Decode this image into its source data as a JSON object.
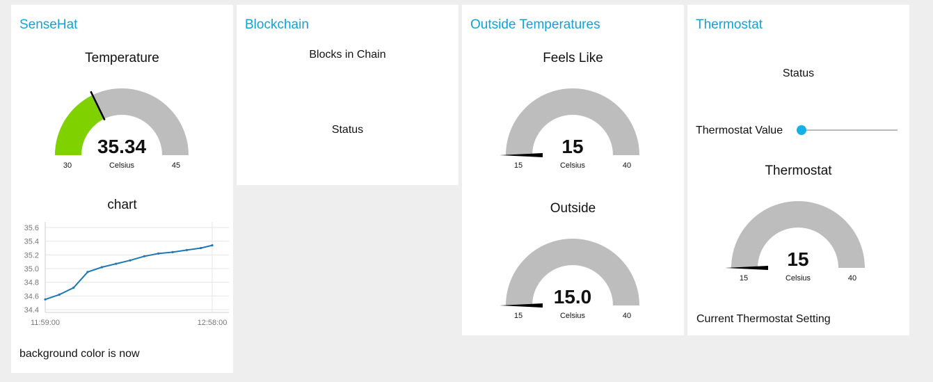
{
  "colors": {
    "background": "#eeeeee",
    "card": "#ffffff",
    "title_accent": "#0fa3d8",
    "gauge_fill": "#7fd100",
    "gauge_empty": "#bdbdbd",
    "chart_line": "#1f77b4",
    "slider_thumb": "#14b1e7"
  },
  "sensehat": {
    "title": "SenseHat",
    "temp_gauge": {
      "title": "Temperature",
      "value": "35.34",
      "unit": "Celsius",
      "min": "30",
      "max": "45",
      "level": 0.356
    },
    "chart_title": "chart",
    "footer": "background color is now"
  },
  "blockchain": {
    "title": "Blockchain",
    "blocks_label": "Blocks in Chain",
    "status_label": "Status"
  },
  "outside": {
    "title": "Outside Temperatures",
    "feels_like": {
      "title": "Feels Like",
      "value": "15",
      "unit": "Celsius",
      "min": "15",
      "max": "40",
      "level": 0
    },
    "outside": {
      "title": "Outside",
      "value": "15.0",
      "unit": "Celsius",
      "min": "15",
      "max": "40",
      "level": 0
    }
  },
  "thermostat": {
    "title": "Thermostat",
    "status_label": "Status",
    "slider_label": "Thermostat Value",
    "slider_level": 0,
    "gauge": {
      "title": "Thermostat",
      "value": "15",
      "unit": "Celsius",
      "min": "15",
      "max": "40",
      "level": 0
    },
    "footer": "Current Thermostat Setting"
  },
  "chart_data": {
    "type": "line",
    "title": "chart",
    "xlabel": "",
    "ylabel": "",
    "x_ticks": [
      "11:59:00",
      "12:58:00"
    ],
    "y_ticks": [
      "34.4",
      "34.6",
      "34.8",
      "35.0",
      "35.2",
      "35.4",
      "35.6"
    ],
    "ylim": [
      34.4,
      35.6
    ],
    "grid": true,
    "series": [
      {
        "x": [
          0,
          5,
          10,
          15,
          20,
          25,
          30,
          35,
          40,
          45,
          50,
          55,
          59
        ],
        "values": [
          34.55,
          34.62,
          34.72,
          34.95,
          35.02,
          35.07,
          35.12,
          35.18,
          35.22,
          35.24,
          35.27,
          35.3,
          35.34
        ]
      }
    ]
  }
}
